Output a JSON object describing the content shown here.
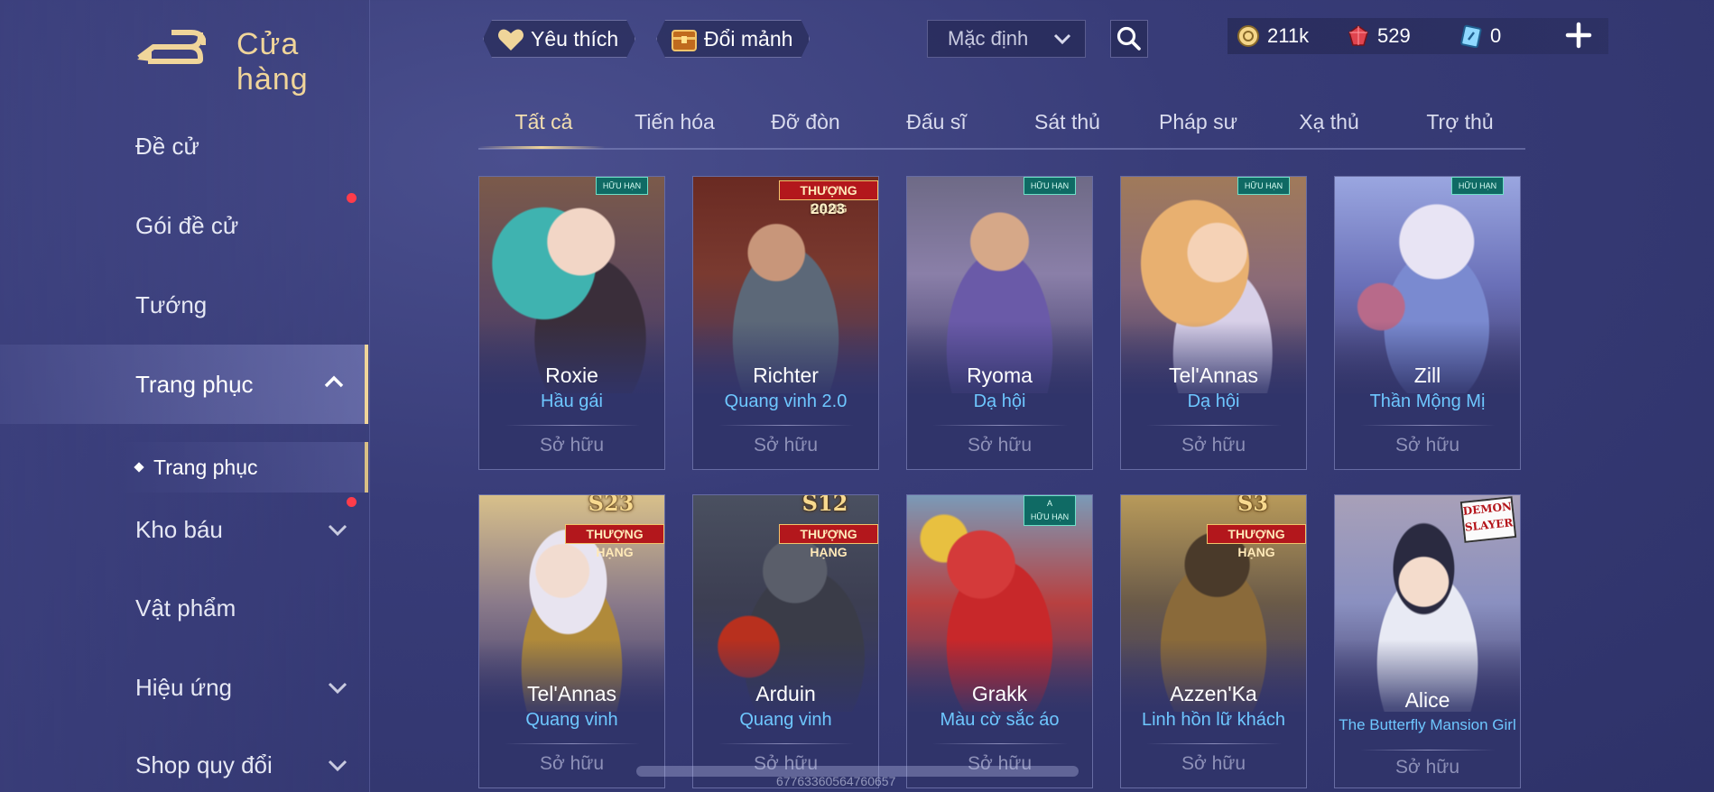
{
  "header": {
    "title": "Cửa hàng"
  },
  "toolbar": {
    "favorites_label": "Yêu thích",
    "exchange_label": "Đổi mảnh",
    "sort_value": "Mặc định"
  },
  "currency": {
    "gold": "211k",
    "ruby": "529",
    "voucher": "0"
  },
  "sidebar": {
    "items": [
      {
        "label": "Đề cử"
      },
      {
        "label": "Gói đề cử"
      },
      {
        "label": "Tướng"
      },
      {
        "label": "Trang phục"
      },
      {
        "label": "Kho báu"
      },
      {
        "label": "Vật phẩm"
      },
      {
        "label": "Hiệu ứng"
      },
      {
        "label": "Shop quy đổi"
      }
    ],
    "sub_item": "Trang phục"
  },
  "tabs": [
    "Tất cả",
    "Tiến hóa",
    "Đỡ đòn",
    "Đấu sĩ",
    "Sát thủ",
    "Pháp sư",
    "Xạ thủ",
    "Trợ thủ"
  ],
  "badges": {
    "limited": "HỮU HẠN",
    "limited_a": "A",
    "rank": "THƯỢNG HẠNG",
    "year": "2023",
    "s23": "S23",
    "s12": "S12",
    "s3": "S3",
    "demon_slayer": "DEMON SLAYER"
  },
  "cards": [
    {
      "hero": "Roxie",
      "skin": "Hầu gái",
      "status": "Sở hữu"
    },
    {
      "hero": "Richter",
      "skin": "Quang vinh 2.0",
      "status": "Sở hữu"
    },
    {
      "hero": "Ryoma",
      "skin": "Dạ hội",
      "status": "Sở hữu"
    },
    {
      "hero": "Tel'Annas",
      "skin": "Dạ hội",
      "status": "Sở hữu"
    },
    {
      "hero": "Zill",
      "skin": "Thần Mộng Mị",
      "status": "Sở hữu"
    },
    {
      "hero": "Tel'Annas",
      "skin": "Quang vinh",
      "status": "Sở hữu"
    },
    {
      "hero": "Arduin",
      "skin": "Quang vinh",
      "status": "Sở hữu"
    },
    {
      "hero": "Grakk",
      "skin": "Màu cờ sắc áo",
      "status": "Sở hữu"
    },
    {
      "hero": "Azzen'Ka",
      "skin": "Linh hồn lữ khách",
      "status": "Sở hữu"
    },
    {
      "hero": "Alice",
      "skin": "The Butterfly Mansion Girl",
      "status": "Sở hữu"
    }
  ],
  "footer_code": "67763360564760657",
  "colors": {
    "accent_gold": "#f0d59a",
    "skin_blue": "#6ec7ff",
    "bg": "#383c78",
    "rank_red": "#b3171c",
    "limited_teal": "#0f6a64"
  }
}
